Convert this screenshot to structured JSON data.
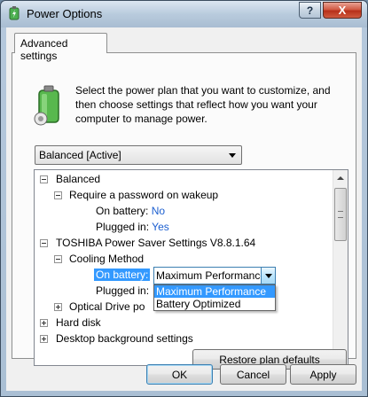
{
  "window": {
    "title": "Power Options",
    "close_label": "X",
    "help_label": "?"
  },
  "tab": {
    "label": "Advanced settings"
  },
  "description": "Select the power plan that you want to customize, and then choose settings that reflect how you want your computer to manage power.",
  "plan_select": {
    "value": "Balanced [Active]"
  },
  "tree": {
    "items": [
      {
        "label": "Balanced"
      },
      {
        "label": "Require a password on wakeup"
      },
      {
        "label": "On battery:",
        "value": "No"
      },
      {
        "label": "Plugged in:",
        "value": "Yes"
      },
      {
        "label": "TOSHIBA Power Saver Settings V8.8.1.64"
      },
      {
        "label": "Cooling Method"
      },
      {
        "label": "On battery:"
      },
      {
        "label": "Plugged in:"
      },
      {
        "label": "Optical Drive po"
      },
      {
        "label": "Hard disk"
      },
      {
        "label": "Desktop background settings"
      }
    ],
    "combo_value": "Maximum Performance",
    "dropdown_options": [
      "Maximum Performance",
      "Battery Optimized"
    ]
  },
  "buttons": {
    "restore": "Restore plan defaults",
    "ok": "OK",
    "cancel": "Cancel",
    "apply": "Apply"
  },
  "colors": {
    "value_text": "#1c5fd0",
    "highlight": "#3399ff"
  }
}
